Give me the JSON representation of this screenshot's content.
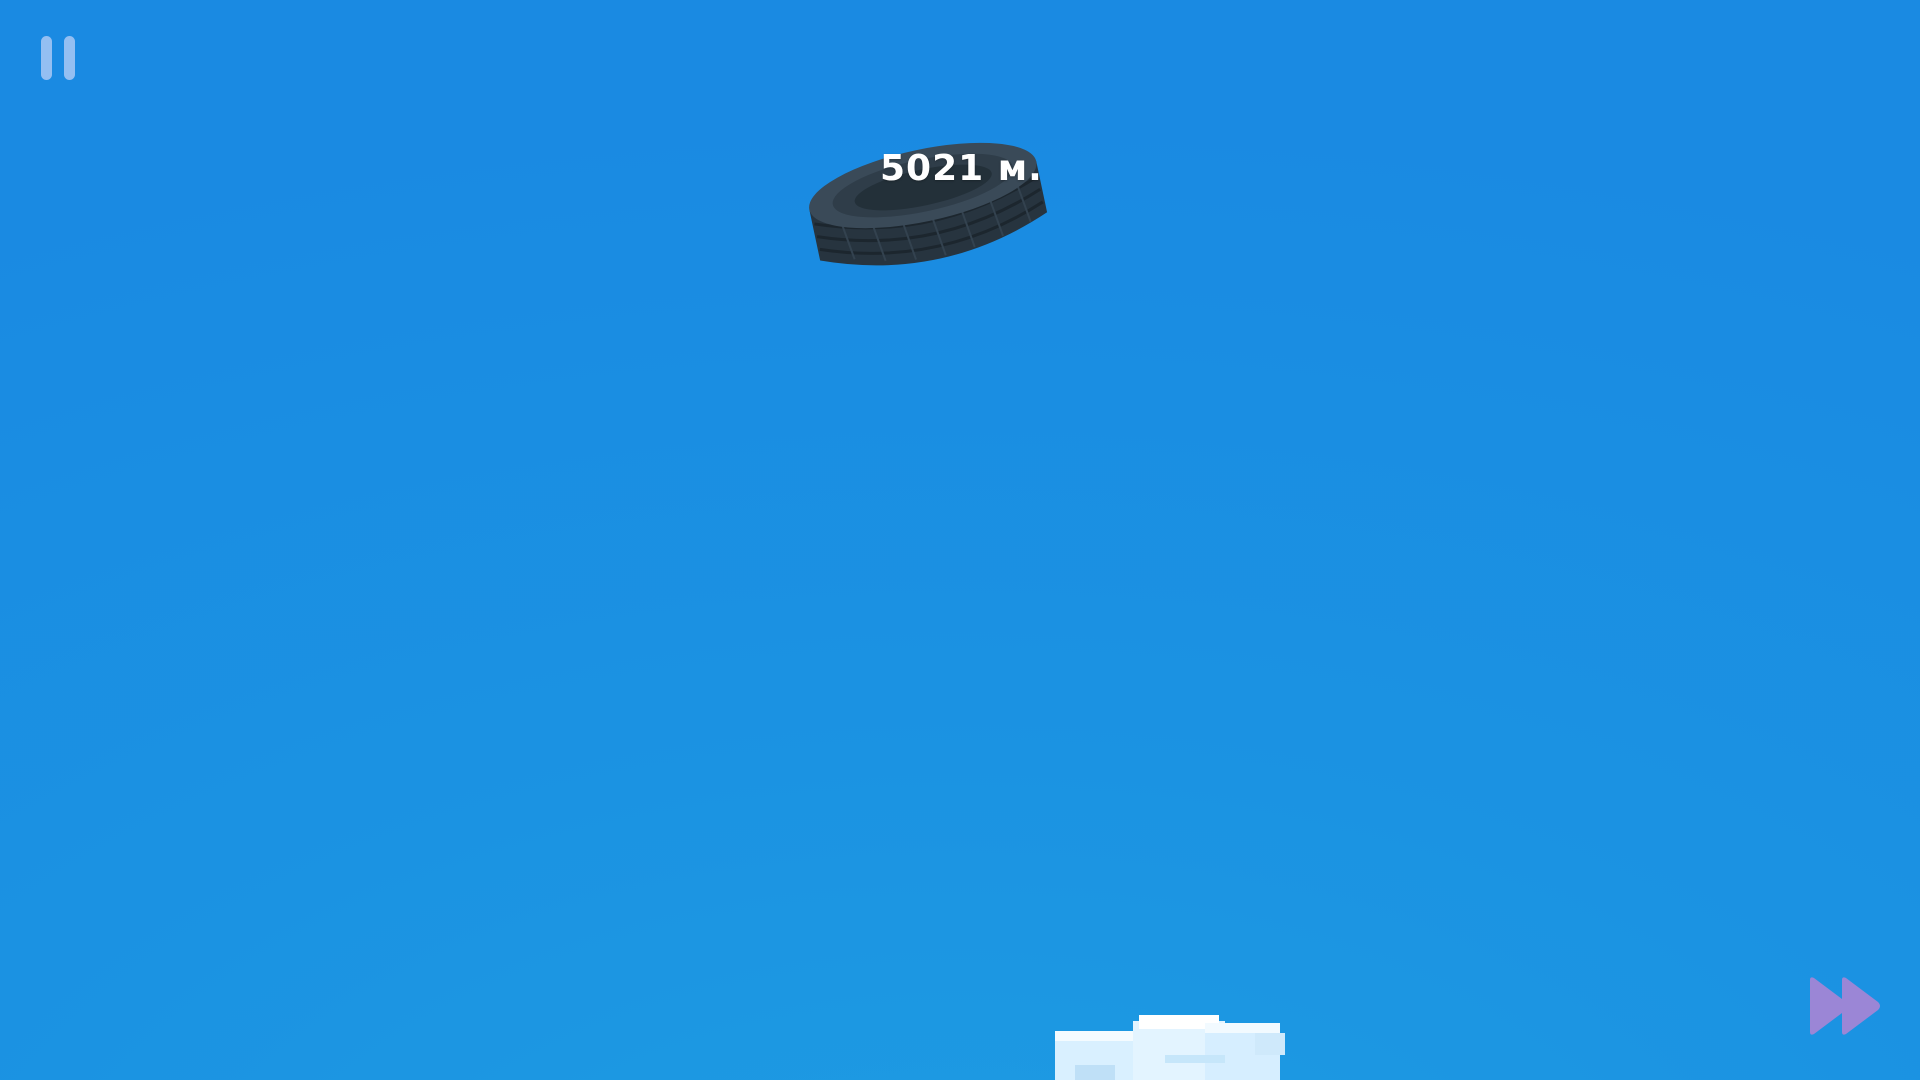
{
  "hud": {
    "distance": "5021 м."
  },
  "icons": {
    "pause": "pause-icon",
    "fast_forward": "fast-forward-icon"
  },
  "colors": {
    "sky": "#1b8fe2",
    "pause": "#aac8f5",
    "fast_forward": "#9b86d6",
    "tire": "#2a3845",
    "cloud": "#eaf6ff"
  }
}
